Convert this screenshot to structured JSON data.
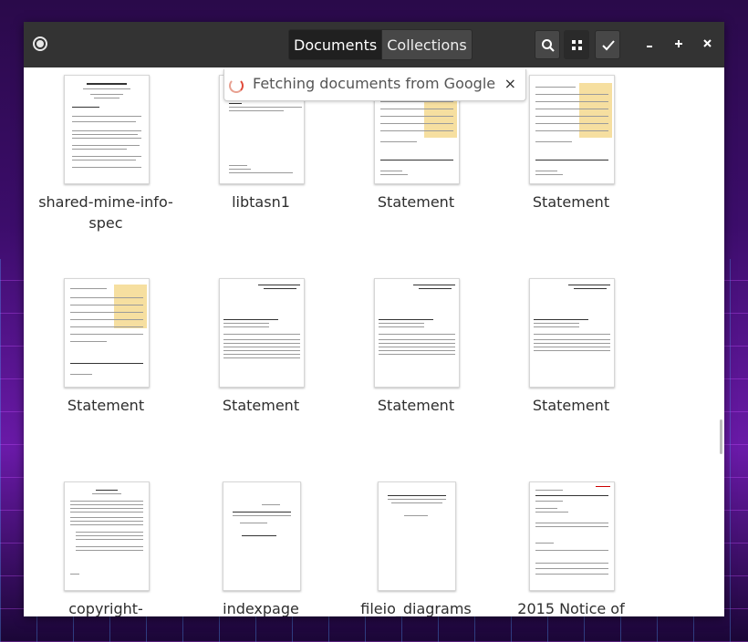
{
  "header": {
    "tabs": [
      {
        "label": "Documents",
        "active": true
      },
      {
        "label": "Collections",
        "active": false
      }
    ],
    "icons": {
      "menu": "menu-icon",
      "search": "search-icon",
      "view": "grid-view-icon",
      "select": "checkmark-icon",
      "minimize": "minimize-icon",
      "maximize": "maximize-icon",
      "close": "close-icon"
    }
  },
  "notification": {
    "text": "Fetching documents from Google",
    "close_glyph": "×"
  },
  "documents": [
    {
      "title": "shared-mime-info-spec"
    },
    {
      "title": "libtasn1"
    },
    {
      "title": "Statement"
    },
    {
      "title": "Statement"
    },
    {
      "title": "Statement"
    },
    {
      "title": "Statement"
    },
    {
      "title": "Statement"
    },
    {
      "title": "Statement"
    },
    {
      "title": "copyright-"
    },
    {
      "title": "indexpage"
    },
    {
      "title": "fileio_diagrams"
    },
    {
      "title": "2015  Notice of"
    }
  ],
  "colors": {
    "headerbar": "#333333",
    "spinner": "#e04a3a",
    "statement_highlight": "#f6dfa0"
  }
}
